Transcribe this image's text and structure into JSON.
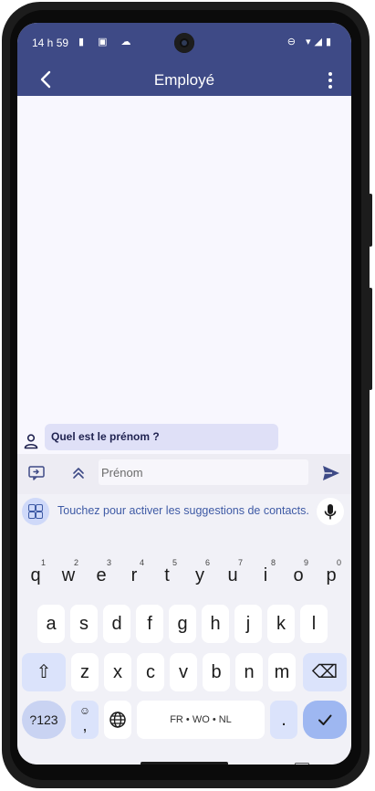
{
  "status_bar": {
    "time": "14 h 59",
    "left_icons": "▮ ▣ ☁",
    "right_icons": "⊖ ▾◢▮"
  },
  "app_bar": {
    "title": "Employé"
  },
  "chat": {
    "messages": [
      {
        "text": "Quel est le prénom ?"
      }
    ]
  },
  "input": {
    "placeholder": "Prénom"
  },
  "keyboard": {
    "suggestion_text": "Touchez pour activer les suggestions de contacts.",
    "row1": [
      {
        "label": "q",
        "hint": "1"
      },
      {
        "label": "w",
        "hint": "2"
      },
      {
        "label": "e",
        "hint": "3"
      },
      {
        "label": "r",
        "hint": "4"
      },
      {
        "label": "t",
        "hint": "5"
      },
      {
        "label": "y",
        "hint": "6"
      },
      {
        "label": "u",
        "hint": "7"
      },
      {
        "label": "i",
        "hint": "8"
      },
      {
        "label": "o",
        "hint": "9"
      },
      {
        "label": "p",
        "hint": "0"
      }
    ],
    "row2": [
      "a",
      "s",
      "d",
      "f",
      "g",
      "h",
      "j",
      "k",
      "l"
    ],
    "row3": [
      "z",
      "x",
      "c",
      "v",
      "b",
      "n",
      "m"
    ],
    "symbols_label": "?123",
    "comma_label": ",",
    "space_label": "FR • WO • NL",
    "period_label": ".",
    "enter_label": "✓",
    "shift_label": "⇧",
    "backspace_label": "⌫",
    "globe_label": "🌐",
    "emoji_label": "☺"
  },
  "colors": {
    "primary": "#3e4a86",
    "bubble": "#dfe0f7",
    "enter_key": "#9eb7f1"
  }
}
